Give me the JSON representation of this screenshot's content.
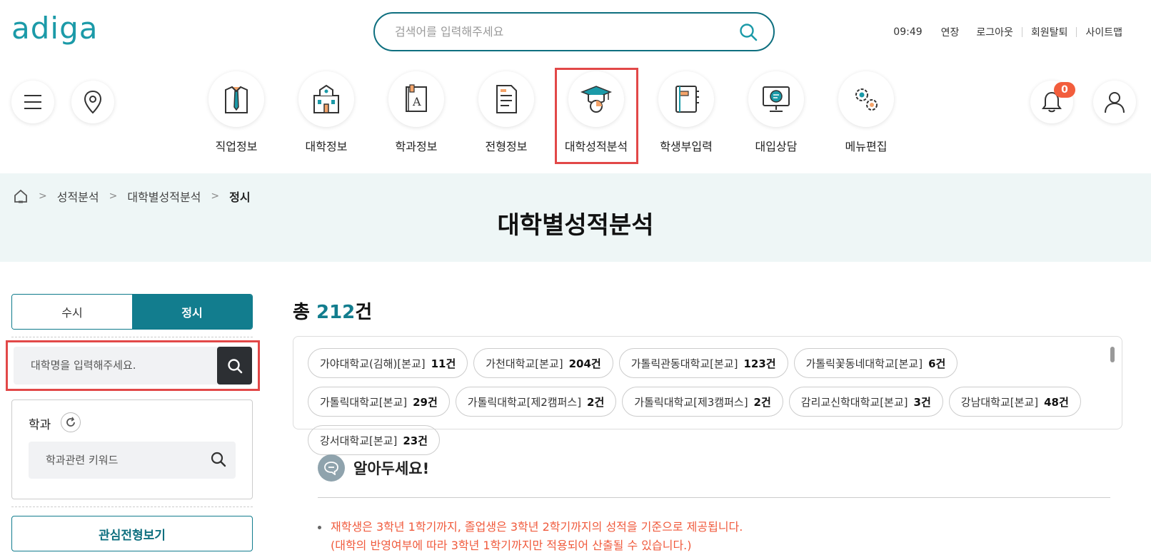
{
  "logo": "adiga",
  "search": {
    "placeholder": "검색어를 입력해주세요"
  },
  "util": {
    "time": "09:49",
    "extend": "연장",
    "logout": "로그아웃",
    "withdraw": "회원탈퇴",
    "sitemap": "사이트맵"
  },
  "nav": [
    {
      "label": "직업정보",
      "icon": "job-icon"
    },
    {
      "label": "대학정보",
      "icon": "university-icon"
    },
    {
      "label": "학과정보",
      "icon": "department-icon"
    },
    {
      "label": "전형정보",
      "icon": "admission-icon"
    },
    {
      "label": "대학성적분석",
      "icon": "graduation-cap-icon"
    },
    {
      "label": "학생부입력",
      "icon": "record-book-icon"
    },
    {
      "label": "대입상담",
      "icon": "consult-icon"
    },
    {
      "label": "메뉴편집",
      "icon": "gear-icon"
    }
  ],
  "notifications": {
    "count": "0"
  },
  "breadcrumb": {
    "level1": "성적분석",
    "level2": "대학별성적분석",
    "level3": "정시"
  },
  "page_title": "대학별성적분석",
  "tabs": {
    "early": "수시",
    "regular": "정시"
  },
  "uni_search": {
    "placeholder": "대학명을 입력해주세요."
  },
  "dept": {
    "title": "학과",
    "placeholder": "학과관련 키워드"
  },
  "interest_button": "관심전형보기",
  "total": {
    "prefix": "총 ",
    "count": "212",
    "suffix": "건"
  },
  "universities": [
    {
      "name": "가야대학교(김해)[본교]",
      "count": "11건"
    },
    {
      "name": "가천대학교[본교]",
      "count": "204건"
    },
    {
      "name": "가톨릭관동대학교[본교]",
      "count": "123건"
    },
    {
      "name": "가톨릭꽃동네대학교[본교]",
      "count": "6건"
    },
    {
      "name": "가톨릭대학교[본교]",
      "count": "29건"
    },
    {
      "name": "가톨릭대학교[제2캠퍼스]",
      "count": "2건"
    },
    {
      "name": "가톨릭대학교[제3캠퍼스]",
      "count": "2건"
    },
    {
      "name": "감리교신학대학교[본교]",
      "count": "3건"
    },
    {
      "name": "강남대학교[본교]",
      "count": "48건"
    },
    {
      "name": "강서대학교[본교]",
      "count": "23건"
    }
  ],
  "notice": {
    "title": "알아두세요!",
    "line1": "재학생은 3학년 1학기까지, 졸업생은 3학년 2학기까지의 성적을 기준으로 제공됩니다.",
    "line2": "(대학의 반영여부에 따라 3학년 1학기까지만 적용되어 산출될 수 있습니다.)"
  }
}
